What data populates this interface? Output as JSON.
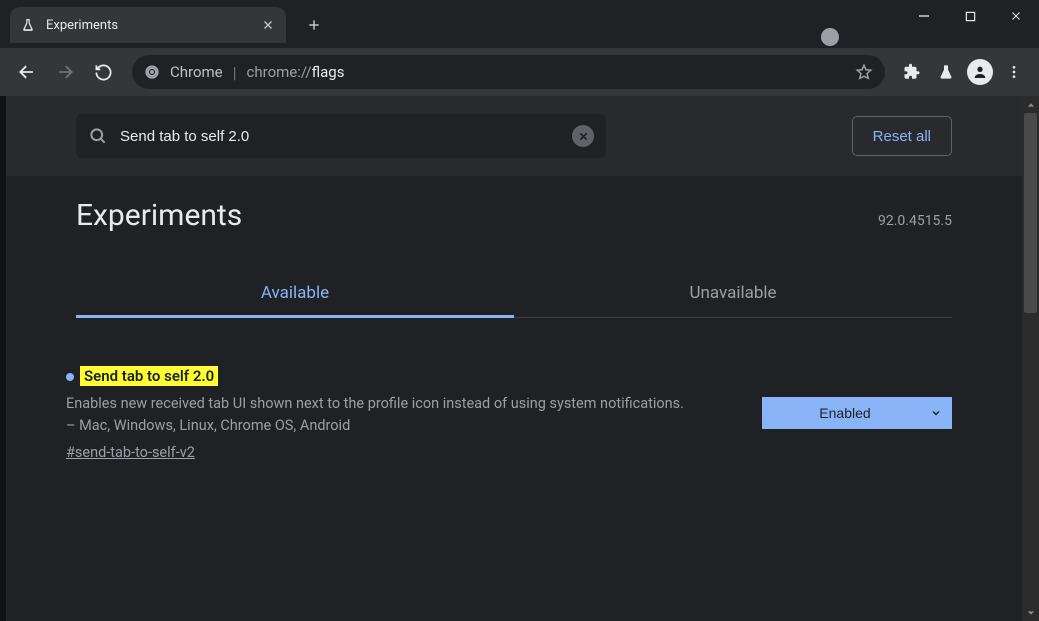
{
  "window": {
    "tab_title": "Experiments"
  },
  "toolbar": {
    "chrome_label": "Chrome",
    "url_scheme": "chrome://",
    "url_path": "flags"
  },
  "flags": {
    "search_value": "Send tab to self 2.0",
    "reset_label": "Reset all",
    "page_title": "Experiments",
    "version": "92.0.4515.5",
    "tabs": {
      "available": "Available",
      "unavailable": "Unavailable"
    },
    "item": {
      "title": "Send tab to self 2.0",
      "description": "Enables new received tab UI shown next to the profile icon instead of using system notifications. – Mac, Windows, Linux, Chrome OS, Android",
      "anchor": "#send-tab-to-self-v2",
      "selected_option": "Enabled"
    }
  }
}
